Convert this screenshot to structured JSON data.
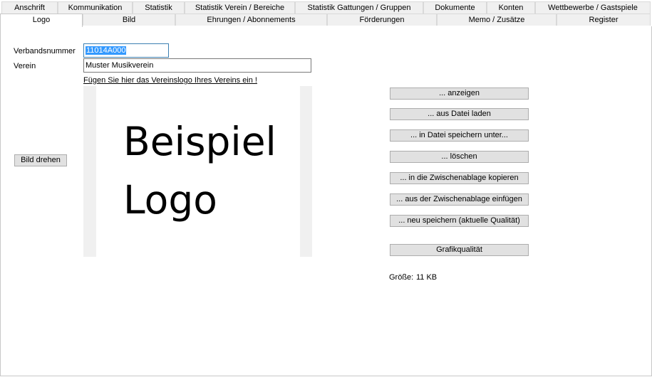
{
  "tabs_row1": [
    "Anschrift",
    "Kommunikation",
    "Statistik",
    "Statistik Verein / Bereiche",
    "Statistik Gattungen / Gruppen",
    "Dokumente",
    "Konten",
    "Wettbewerbe / Gastspiele"
  ],
  "tabs_row2": [
    "Logo",
    "Bild",
    "Ehrungen / Abonnements",
    "Förderungen",
    "Memo / Zusätze",
    "Register"
  ],
  "form": {
    "verbandsnummer_label": "Verbandsnummer",
    "verbandsnummer_value": "11014A000",
    "verein_label": "Verein",
    "verein_value": "Muster Musikverein",
    "hint_link": "Fügen Sie hier das Vereinslogo Ihres Vereins ein !"
  },
  "logo": {
    "line1": "Beispiel",
    "line2": "Logo"
  },
  "buttons": {
    "rotate": "Bild drehen",
    "show": "... anzeigen",
    "load": "... aus Datei laden",
    "save_as": "... in Datei speichern unter...",
    "delete": "... löschen",
    "copy": "... in die Zwischenablage kopieren",
    "paste": "... aus der Zwischenablage einfügen",
    "resave": "... neu speichern (aktuelle Qualität)",
    "quality": "Grafikqualität"
  },
  "size": {
    "label": "Größe:",
    "value": "11 KB"
  }
}
